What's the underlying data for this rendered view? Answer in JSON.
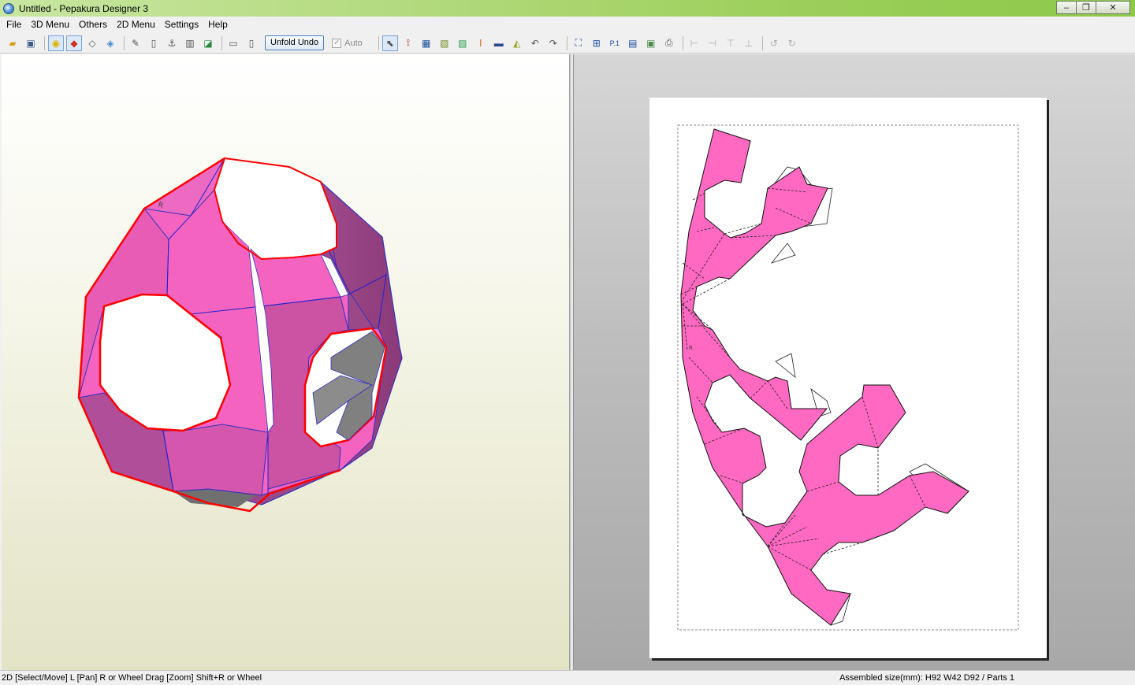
{
  "window": {
    "title": "Untitled - Pepakura Designer 3",
    "controls": {
      "minimize": "–",
      "maximize": "❐",
      "close": "✕"
    }
  },
  "menu": [
    "File",
    "3D Menu",
    "Others",
    "2D Menu",
    "Settings",
    "Help"
  ],
  "toolbar": {
    "unfold_undo_label": "Unfold Undo",
    "auto_label": "Auto",
    "auto_checked": true,
    "icons_3d": [
      "open-folder-icon",
      "save-icon",
      "light-icon",
      "color-cube-icon",
      "wireframe-cube-icon",
      "shaded-cube-icon",
      "pencil-icon",
      "cylinder-icon",
      "anchor-icon",
      "box-icon",
      "fold-icon",
      "panel-single-icon",
      "panel-split-icon"
    ],
    "icons_2d": [
      "select-arrow-icon",
      "join-icon",
      "grid-icon",
      "flap-icon",
      "paint-icon",
      "text-icon",
      "image-icon",
      "edge-icon",
      "rotate-ccw-icon",
      "rotate-cw-icon",
      "fit-icon",
      "arrange-icon",
      "page-number-icon",
      "layout-icon",
      "print-preview-icon",
      "print-icon"
    ],
    "icons_align": [
      "align-left-icon",
      "align-right-icon",
      "align-top-icon",
      "align-bottom-icon",
      "rotate-90-left-icon",
      "rotate-90-right-icon"
    ]
  },
  "model_3d": {
    "part_label": "R",
    "face_color": "#f565c0",
    "edge_color": "#ff0000",
    "fold_color": "#2020d0"
  },
  "layout_2d": {
    "part_label": "R",
    "face_color": "#ff69c2"
  },
  "status": {
    "left": "2D [Select/Move] L [Pan] R or Wheel Drag [Zoom] Shift+R or Wheel",
    "right": "Assembled size(mm): H92 W42 D92 / Parts 1"
  }
}
